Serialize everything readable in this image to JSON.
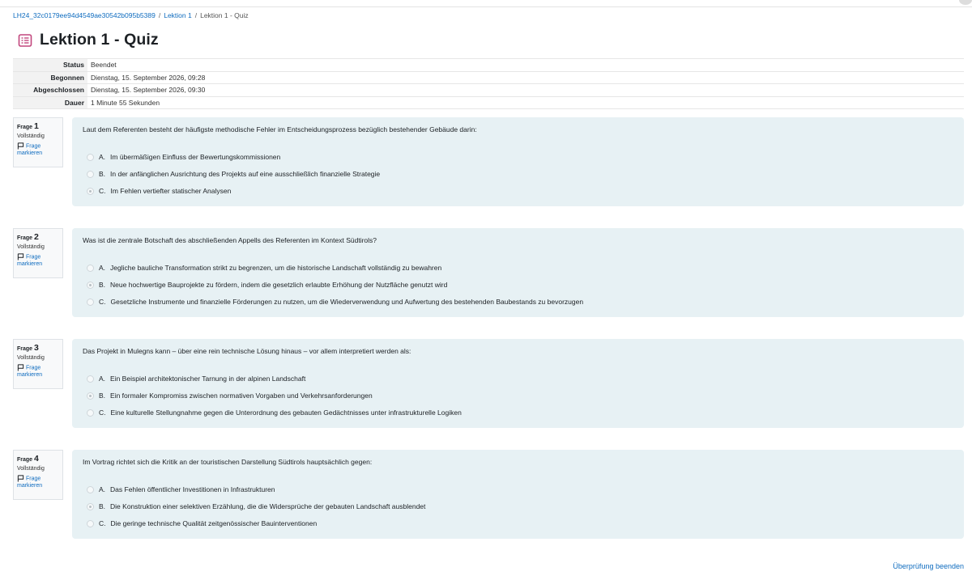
{
  "breadcrumb": [
    "LH24_32c0179ee94d4549ae30542b095b5389",
    "Lektion 1",
    "Lektion 1 - Quiz"
  ],
  "page_title": "Lektion 1 - Quiz",
  "summary": [
    {
      "label": "Status",
      "value": "Beendet"
    },
    {
      "label": "Begonnen",
      "value": "Dienstag, 15. September 2026, 09:28"
    },
    {
      "label": "Abgeschlossen",
      "value": "Dienstag, 15. September 2026, 09:30"
    },
    {
      "label": "Dauer",
      "value": "1 Minute 55 Sekunden"
    }
  ],
  "question_label": "Frage",
  "state_label": "Vollständig",
  "flag_label": "Frage markieren",
  "questions": [
    {
      "number": "1",
      "text": "Laut dem Referenten besteht der häufigste methodische Fehler im Entscheidungsprozess bezüglich bestehender Gebäude darin:",
      "selected": 2,
      "answers": [
        {
          "letter": "A.",
          "text": "Im übermäßigen Einfluss der Bewertungskommissionen"
        },
        {
          "letter": "B.",
          "text": "In der anfänglichen Ausrichtung des Projekts auf eine ausschließlich finanzielle Strategie"
        },
        {
          "letter": "C.",
          "text": "Im Fehlen vertiefter statischer Analysen"
        }
      ]
    },
    {
      "number": "2",
      "text": "Was ist die zentrale Botschaft des abschließenden Appells des Referenten im Kontext Südtirols?",
      "selected": 1,
      "answers": [
        {
          "letter": "A.",
          "text": "Jegliche bauliche Transformation strikt zu begrenzen, um die historische Landschaft vollständig zu bewahren"
        },
        {
          "letter": "B.",
          "text": "Neue hochwertige Bauprojekte zu fördern, indem die gesetzlich erlaubte Erhöhung der Nutzfläche genutzt wird"
        },
        {
          "letter": "C.",
          "text": "Gesetzliche Instrumente und finanzielle Förderungen zu nutzen, um die Wiederverwendung und Aufwertung des bestehenden Baubestands zu bevorzugen"
        }
      ]
    },
    {
      "number": "3",
      "text": "Das Projekt in Mulegns kann – über eine rein technische Lösung hinaus – vor allem interpretiert werden als:",
      "selected": 1,
      "answers": [
        {
          "letter": "A.",
          "text": "Ein Beispiel architektonischer Tarnung in der alpinen Landschaft"
        },
        {
          "letter": "B.",
          "text": "Ein formaler Kompromiss zwischen normativen Vorgaben und Verkehrsanforderungen"
        },
        {
          "letter": "C.",
          "text": "Eine kulturelle Stellungnahme gegen die Unterordnung des gebauten Gedächtnisses unter infrastrukturelle Logiken"
        }
      ]
    },
    {
      "number": "4",
      "text": "Im Vortrag richtet sich die Kritik an der touristischen Darstellung Südtirols hauptsächlich gegen:",
      "selected": 1,
      "answers": [
        {
          "letter": "A.",
          "text": "Das Fehlen öffentlicher Investitionen in Infrastrukturen"
        },
        {
          "letter": "B.",
          "text": "Die Konstruktion einer selektiven Erzählung, die die Widersprüche der gebauten Landschaft ausblendet"
        },
        {
          "letter": "C.",
          "text": "Die geringe technische Qualität zeitgenössischer Bauinterventionen"
        }
      ]
    }
  ],
  "finish_review": "Überprüfung beenden",
  "colors": {
    "link": "#0f6cbf",
    "question_bg": "#e7f1f4",
    "icon": "#c2467d"
  }
}
